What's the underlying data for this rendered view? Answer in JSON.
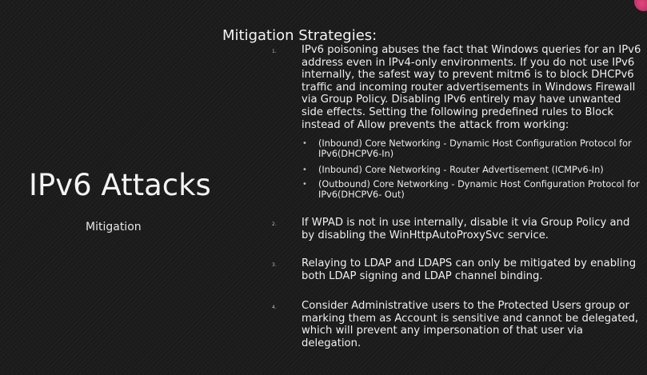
{
  "left": {
    "title": "IPv6 Attacks",
    "subtitle": "Mitigation"
  },
  "heading": "Mitigation Strategies:",
  "items": [
    {
      "num": "1.",
      "text": "IPv6 poisoning abuses the fact that Windows queries for an IPv6 address even in IPv4-only environments. If you do not use IPv6 internally, the safest way to prevent mitm6 is to block DHCPv6 traffic and incoming router advertisements in Windows Firewall via Group Policy. Disabling IPv6 entirely may have unwanted side effects. Setting the following predefined rules to Block instead of Allow prevents the attack from working:"
    },
    {
      "num": "2.",
      "text": "If WPAD is not in use internally, disable it via Group Policy and by disabling the WinHttpAutoProxySvc service."
    },
    {
      "num": "3.",
      "text": "Relaying to LDAP and LDAPS can only be mitigated by enabling both LDAP signing and LDAP channel binding."
    },
    {
      "num": "4.",
      "text": "Consider Administrative users to the Protected Users group or marking them as Account is sensitive and cannot be delegated, which will prevent any impersonation of that user via delegation."
    }
  ],
  "subitems": [
    {
      "bullet": "•",
      "text": "(Inbound) Core Networking - Dynamic Host Configuration Protocol for IPv6(DHCPV6-In)"
    },
    {
      "bullet": "•",
      "text": "(Inbound) Core Networking - Router Advertisement (ICMPv6-In)"
    },
    {
      "bullet": "•",
      "text": "(Outbound) Core Networking - Dynamic Host Configuration Protocol for IPv6(DHCPV6- Out)"
    }
  ]
}
